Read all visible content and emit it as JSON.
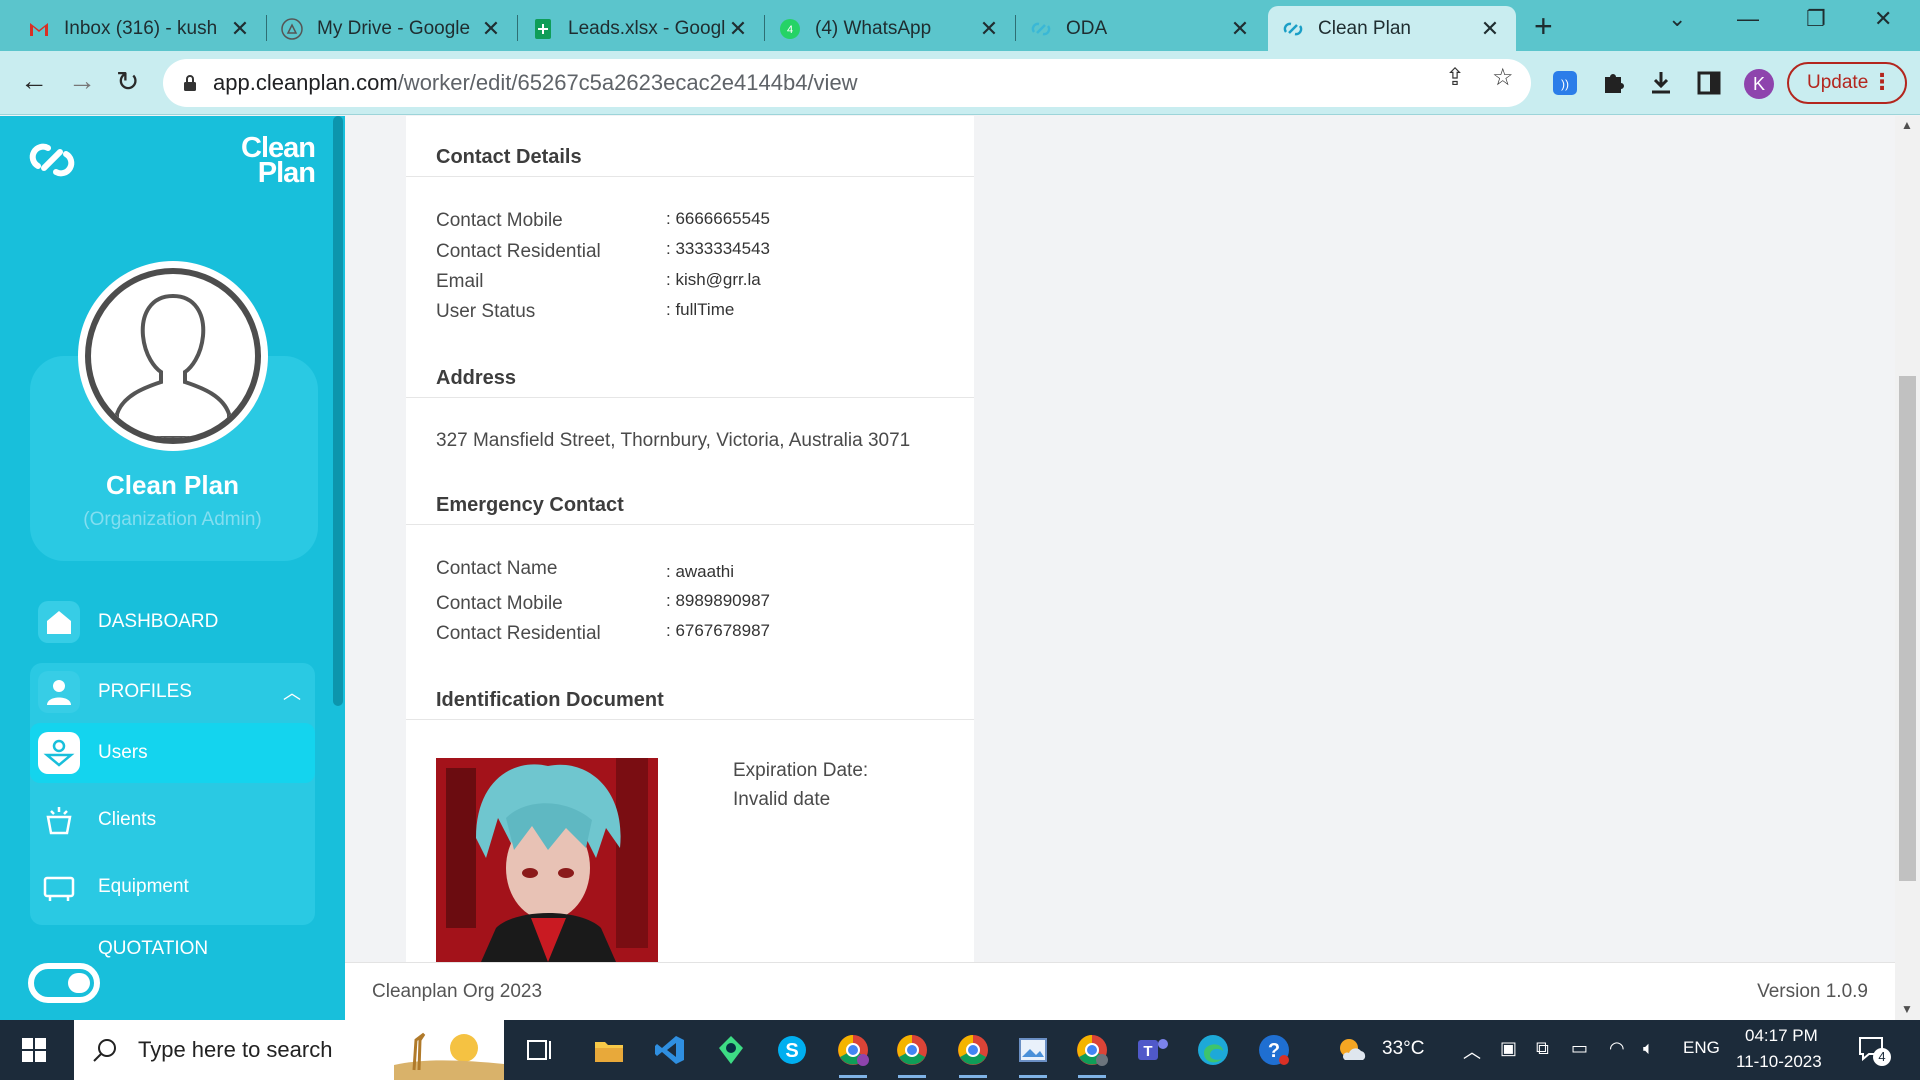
{
  "browser": {
    "tabs": [
      {
        "title": "Inbox (316) - kush",
        "icon": "gmail-icon"
      },
      {
        "title": "My Drive - Google",
        "icon": "google-drive-icon"
      },
      {
        "title": "Leads.xlsx - Googl",
        "icon": "google-sheets-icon"
      },
      {
        "title": "(4) WhatsApp",
        "icon": "whatsapp-icon"
      },
      {
        "title": "ODA",
        "icon": "cleanplan-icon"
      },
      {
        "title": "Clean Plan",
        "icon": "cleanplan-icon"
      }
    ],
    "new_tab_label": "+",
    "url_host": "app.cleanplan.com",
    "url_path": "/worker/edit/65267c5a2623ecac2e4144b4/view",
    "profile_initial": "K",
    "update_label": "Update"
  },
  "sidebar": {
    "brand_line1": "Clean",
    "brand_line2": "Plan",
    "profile_name": "Clean Plan",
    "profile_role": "(Organization Admin)",
    "items": [
      {
        "label": "DASHBOARD",
        "icon": "home-icon"
      },
      {
        "label": "PROFILES",
        "icon": "user-icon"
      },
      {
        "label": "Users",
        "icon": "users-icon"
      },
      {
        "label": "Clients",
        "icon": "clients-icon"
      },
      {
        "label": "Equipment",
        "icon": "equipment-icon"
      },
      {
        "label": "QUOTATION",
        "icon": "quotation-icon"
      }
    ]
  },
  "contact": {
    "title": "Contact Details",
    "rows": [
      {
        "label": "Contact Mobile",
        "value": ": 6666665545"
      },
      {
        "label": "Contact Residential",
        "value": ": 3333334543"
      },
      {
        "label": "Email",
        "value": ": kish@grr.la"
      },
      {
        "label": "User Status",
        "value": ": fullTime"
      }
    ]
  },
  "address": {
    "title": "Address",
    "text": "327 Mansfield Street, Thornbury, Victoria, Australia 3071"
  },
  "emergency": {
    "title": "Emergency Contact",
    "rows": [
      {
        "label": "Contact Name",
        "value": ": awaathi"
      },
      {
        "label": "Contact Mobile",
        "value": ": 8989890987"
      },
      {
        "label": "Contact Residential",
        "value": ": 6767678987"
      }
    ]
  },
  "identification": {
    "title": "Identification Document",
    "expiration_label": "Expiration Date:",
    "expiration_value": "Invalid date"
  },
  "footer": {
    "left": "Cleanplan Org 2023",
    "right": "Version 1.0.9"
  },
  "taskbar": {
    "search_placeholder": "Type here to search",
    "weather": "33°C",
    "language": "ENG",
    "time": "04:17 PM",
    "date": "11-10-2023",
    "notification_count": "4"
  },
  "colors": {
    "sidebar": "#18bfdb",
    "tabbar": "#5bc5cc",
    "toolbar": "#c9edf0",
    "update_red": "#b3261e"
  }
}
